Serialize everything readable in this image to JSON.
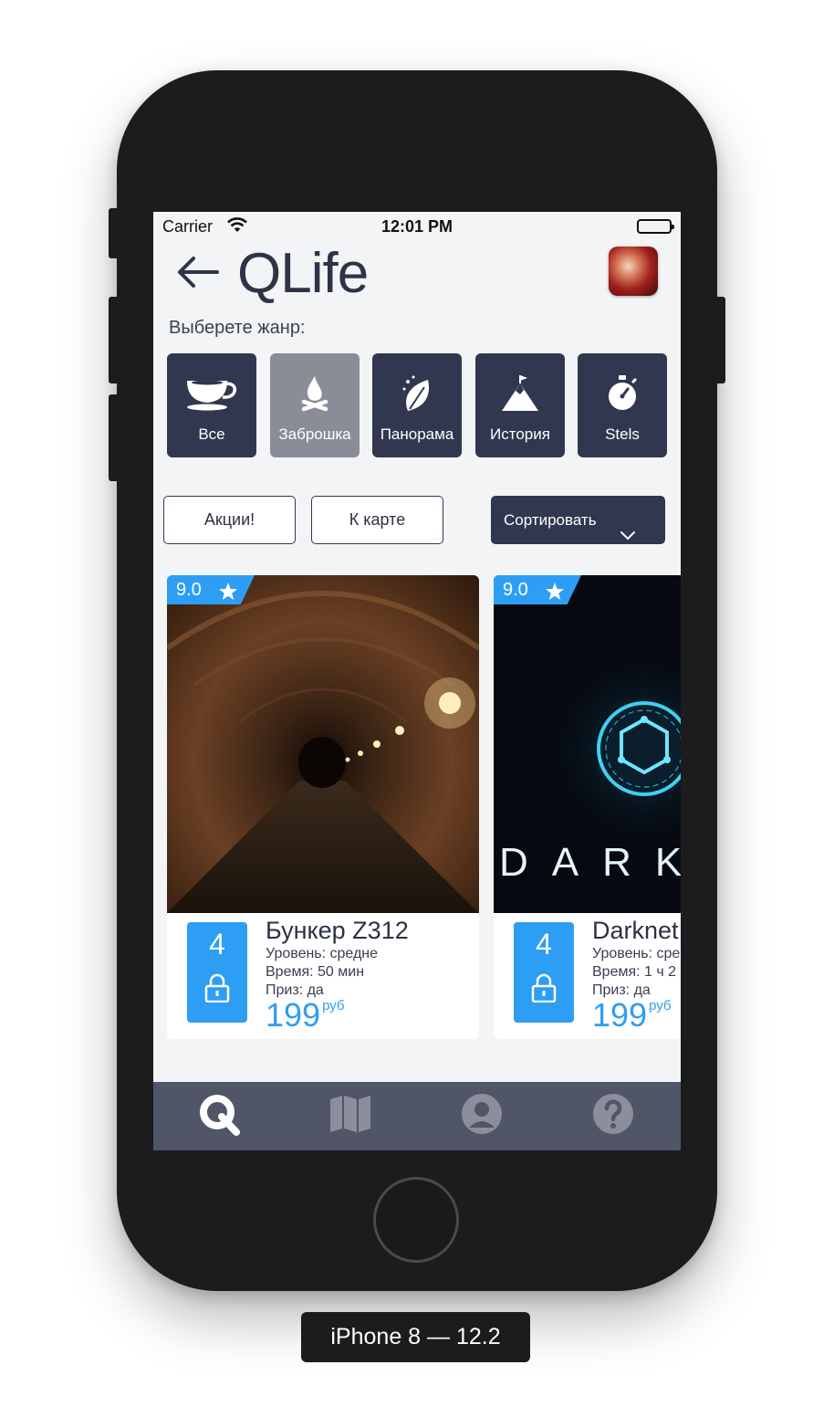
{
  "status_bar": {
    "carrier": "Carrier",
    "time": "12:01 PM"
  },
  "header": {
    "title": "QLife"
  },
  "genre_prompt": "Выберете жанр:",
  "genres": [
    {
      "label": "Все",
      "icon": "coffee-cup-icon",
      "active": false
    },
    {
      "label": "Заброшка",
      "icon": "campfire-icon",
      "active": true
    },
    {
      "label": "Панорама",
      "icon": "leaf-icon",
      "active": false
    },
    {
      "label": "История",
      "icon": "mountain-flag-icon",
      "active": false
    },
    {
      "label": "Stels",
      "icon": "stopwatch-icon",
      "active": false
    }
  ],
  "actions": {
    "promo": "Акции!",
    "map": "К карте",
    "sort": "Сортировать"
  },
  "quests": [
    {
      "rating": "9.0",
      "players": "4",
      "name": "Бункер Z312",
      "level": "Уровень: средне",
      "time": "Время: 50 мин",
      "prize": "Приз: да",
      "price": "199",
      "currency": "руб"
    },
    {
      "rating": "9.0",
      "players": "4",
      "name": "Darknet",
      "level": "Уровень: сре",
      "time": "Время: 1 ч 2",
      "prize": "Приз: да",
      "price": "199",
      "currency": "руб",
      "poster_text": "DARK"
    }
  ],
  "tabs": [
    "q-logo-icon",
    "map-icon",
    "profile-icon",
    "help-icon"
  ],
  "colors": {
    "navy": "#323750",
    "accent": "#2d9ef4",
    "tabbar": "#505568"
  },
  "device_caption": "iPhone 8 — 12.2"
}
